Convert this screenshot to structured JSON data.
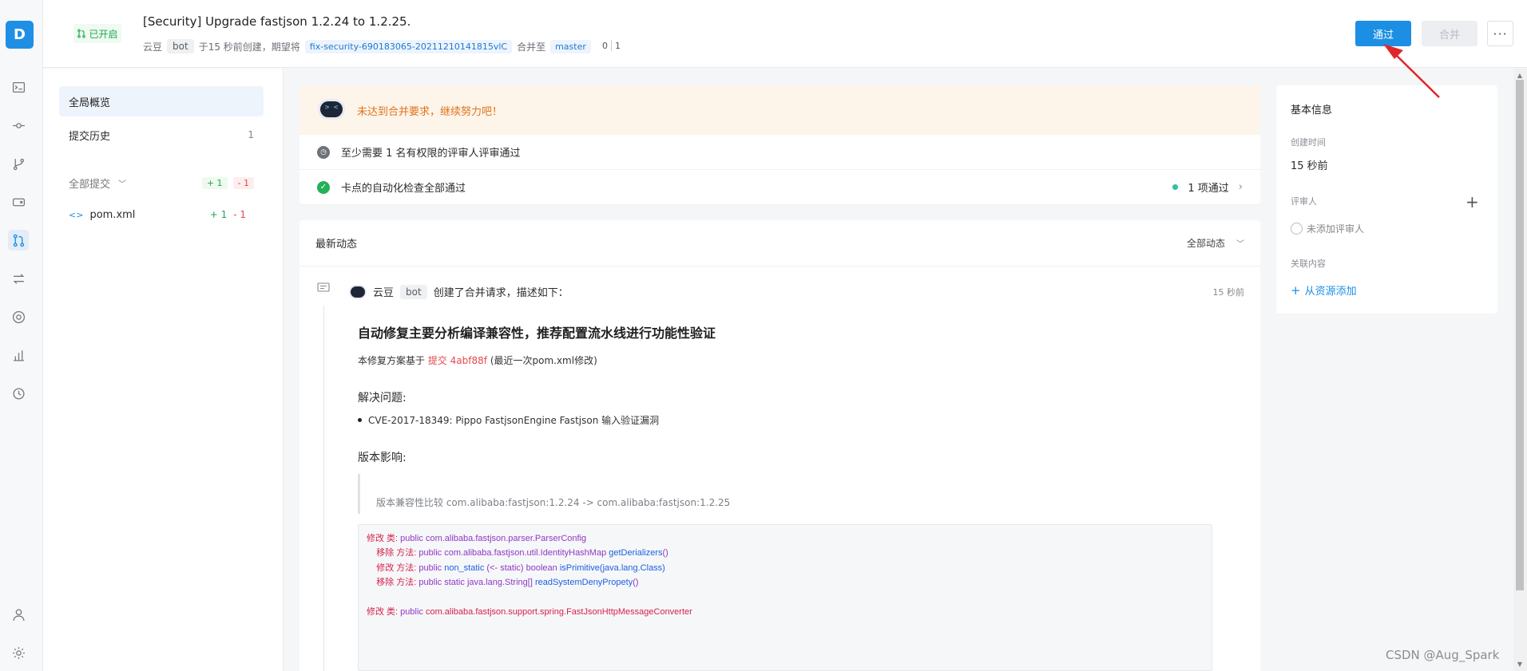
{
  "app": {
    "logo_letter": "D"
  },
  "rail": [
    {
      "name": "terminal-icon"
    },
    {
      "name": "commit-icon"
    },
    {
      "name": "branch-icon"
    },
    {
      "name": "tag-icon"
    },
    {
      "name": "merge-request-icon"
    },
    {
      "name": "transfer-icon"
    },
    {
      "name": "eye-icon"
    },
    {
      "name": "chart-icon"
    },
    {
      "name": "history-icon"
    },
    {
      "name": "user-icon"
    },
    {
      "name": "settings-icon"
    }
  ],
  "header": {
    "status": "已开启",
    "title": "[Security] Upgrade fastjson 1.2.24 to 1.2.25.",
    "author": "云豆",
    "author_tag": "bot",
    "created_text": "于15 秒前创建，期望将",
    "source_branch": "fix-security-690183065-20211210141815vlC",
    "merge_into": "合并至",
    "target_branch": "master",
    "count_a": "0",
    "count_b": "1",
    "approve": "通过",
    "merge": "合并",
    "more": "···"
  },
  "filebar": {
    "overview": "全局概览",
    "history": "提交历史",
    "history_count": "1",
    "all_commits": "全部提交",
    "add_badge": "+ 1",
    "del_badge": "- 1",
    "file_name": "pom.xml",
    "file_add": "+ 1",
    "file_del": "- 1"
  },
  "merge_status": {
    "warning": "未达到合并要求，继续努力吧！",
    "review_rule": "至少需要 1 名有权限的评审人评审通过",
    "ci_rule": "卡点的自动化检查全部通过",
    "ci_result": "1 项通过"
  },
  "activity": {
    "title": "最新动态",
    "filter": "全部动态",
    "actor": "云豆",
    "actor_tag": "bot",
    "action": "创建了合并请求，描述如下：",
    "time": "15 秒前",
    "desc_title": "自动修复主要分析编译兼容性，推荐配置流水线进行功能性验证",
    "desc_base_prefix": "本修复方案基于",
    "desc_base_commit": "提交 4abf88f",
    "desc_base_suffix": "(最近一次pom.xml修改)",
    "resolve_heading": "解决问题:",
    "issue": "CVE-2017-18349: Pippo FastjsonEngine Fastjson 输入验证漏洞",
    "impact_heading": "版本影响:",
    "quote": "版本兼容性比较 com.alibaba:fastjson:1.2.24 -> com.alibaba:fastjson:1.2.25",
    "code": [
      {
        "indent": "",
        "a": "修改 类: ",
        "b": "public ",
        "c": "com.alibaba.fastjson.parser.ParserConfig",
        "d": "",
        "e": ""
      },
      {
        "indent": "    ",
        "a": "移除 方法: ",
        "b": "public ",
        "c": "com.alibaba.fastjson.util.IdentityHashMap ",
        "d": "getDerializers",
        "e": "()"
      },
      {
        "indent": "    ",
        "a": "修改 方法: ",
        "b": "public ",
        "c": "non_static ",
        "d": "(<- static) boolean ",
        "e": "isPrimitive(java.lang.Class)"
      },
      {
        "indent": "    ",
        "a": "移除 方法: ",
        "b": "public static ",
        "c": "java.lang.String[] ",
        "d": "readSystemDenyPropety",
        "e": "()"
      },
      {
        "indent": "",
        "a": "",
        "b": "",
        "c": "",
        "d": "",
        "e": ""
      },
      {
        "indent": "",
        "a": "修改 类: ",
        "b": "public ",
        "c": "com.alibaba.fastjson.support.spring.FastJsonHttpMessageConverter",
        "d": "",
        "e": ""
      }
    ]
  },
  "info": {
    "title": "基本信息",
    "created_label": "创建时间",
    "created_value": "15 秒前",
    "reviewer_label": "评审人",
    "no_reviewer": "未添加评审人",
    "related_label": "关联内容",
    "add_from_resource": "从资源添加"
  },
  "watermark": "CSDN @Aug_Spark",
  "colors": {
    "accent": "#1c8fe4",
    "success": "#25b158",
    "warning": "#e0741c",
    "danger": "#e5484d"
  }
}
